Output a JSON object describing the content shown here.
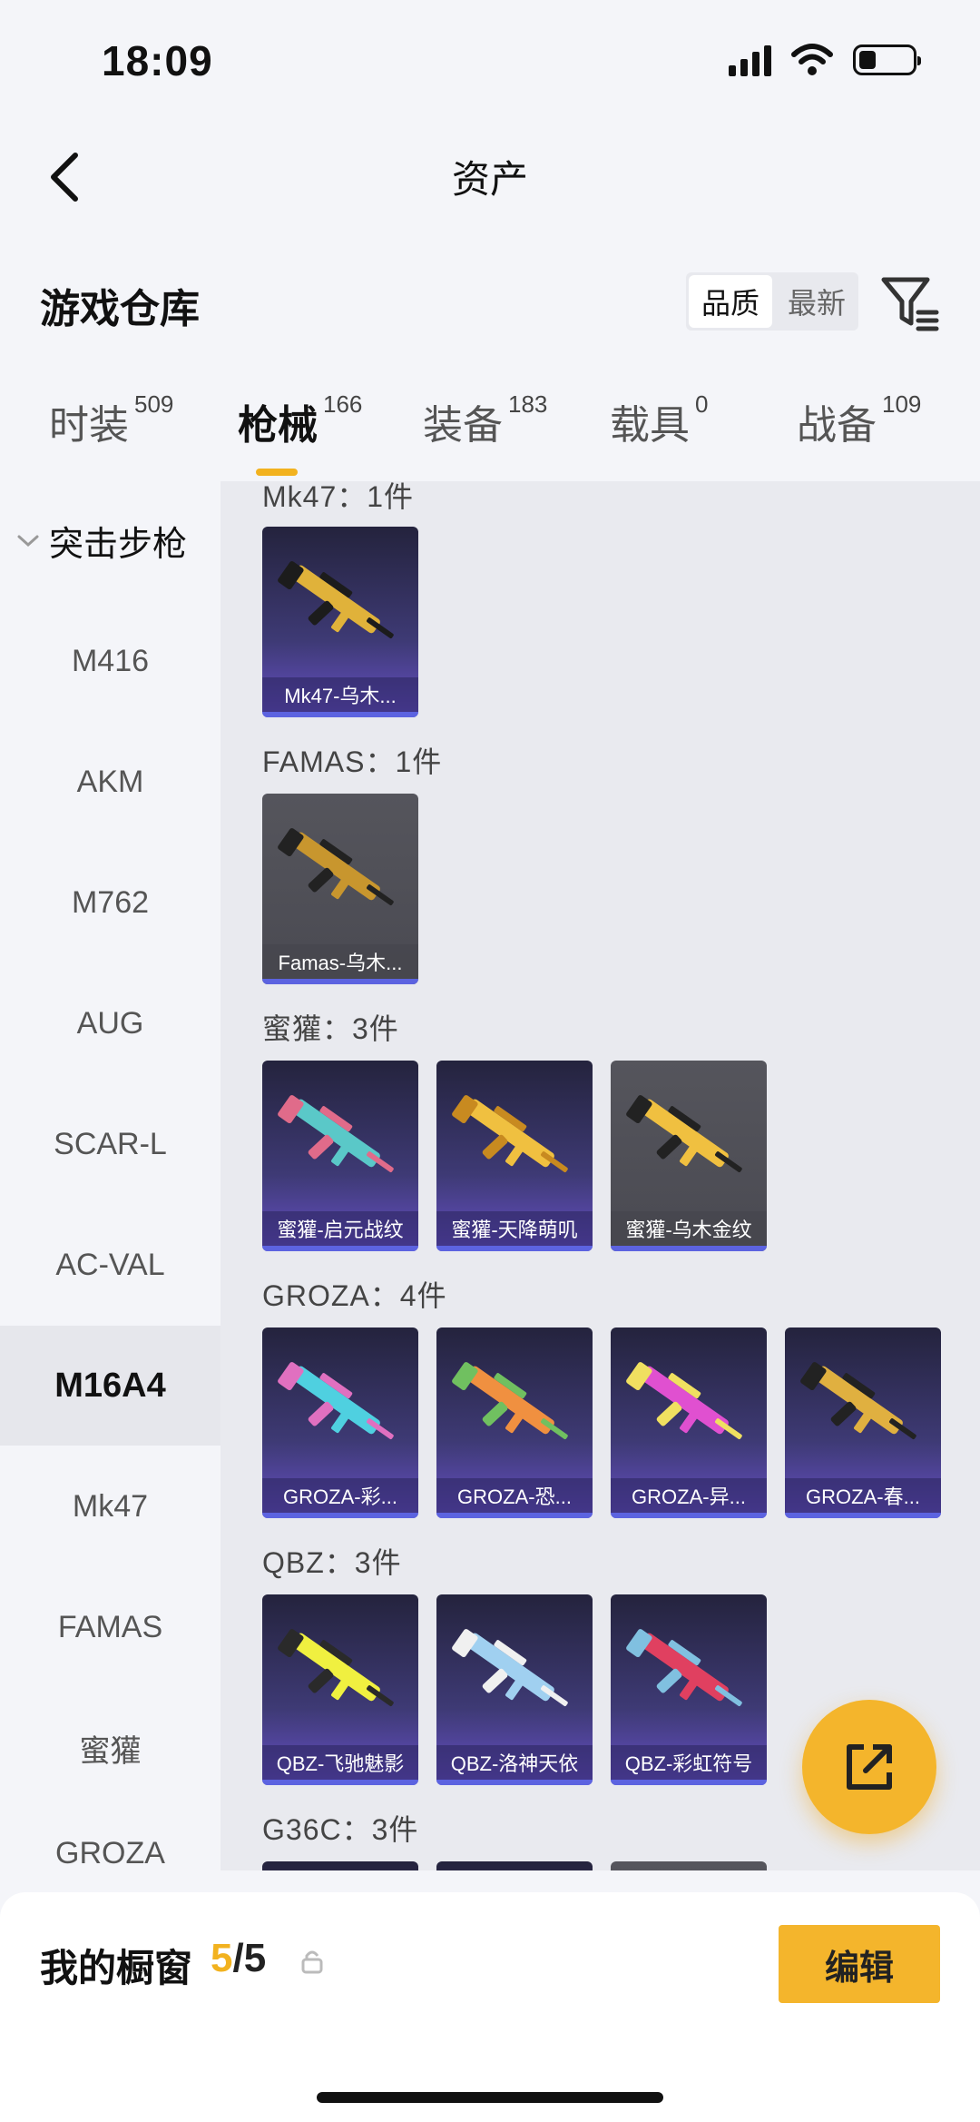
{
  "status": {
    "time": "18:09"
  },
  "nav": {
    "title": "资产"
  },
  "header": {
    "title": "游戏仓库",
    "sort_options": [
      "品质",
      "最新"
    ],
    "sort_active": "品质"
  },
  "tabs": [
    {
      "label": "时装",
      "count": "509"
    },
    {
      "label": "枪械",
      "count": "166"
    },
    {
      "label": "装备",
      "count": "183"
    },
    {
      "label": "载具",
      "count": "0"
    },
    {
      "label": "战备",
      "count": "109"
    }
  ],
  "active_tab": "枪械",
  "sidebar": {
    "category": "突击步枪",
    "items": [
      "M416",
      "AKM",
      "M762",
      "AUG",
      "SCAR-L",
      "AC-VAL",
      "M16A4",
      "Mk47",
      "FAMAS",
      "蜜獾",
      "GROZA"
    ],
    "active_item": "M16A4"
  },
  "groups": [
    {
      "title": "Mk47：1件",
      "items": [
        {
          "name": "Mk47-乌木...",
          "style": "purple"
        }
      ]
    },
    {
      "title": "FAMAS：1件",
      "items": [
        {
          "name": "Famas-乌木...",
          "style": "grey"
        }
      ]
    },
    {
      "title": "蜜獾：3件",
      "items": [
        {
          "name": "蜜獾-启元战纹",
          "style": "purple"
        },
        {
          "name": "蜜獾-天降萌叽",
          "style": "purple"
        },
        {
          "name": "蜜獾-乌木金纹",
          "style": "grey"
        }
      ]
    },
    {
      "title": "GROZA：4件",
      "items": [
        {
          "name": "GROZA-彩...",
          "style": "purple"
        },
        {
          "name": "GROZA-恐...",
          "style": "purple"
        },
        {
          "name": "GROZA-异...",
          "style": "purple"
        },
        {
          "name": "GROZA-春...",
          "style": "purple"
        }
      ]
    },
    {
      "title": "QBZ：3件",
      "items": [
        {
          "name": "QBZ-飞驰魅影",
          "style": "purple"
        },
        {
          "name": "QBZ-洛神天依",
          "style": "purple"
        },
        {
          "name": "QBZ-彩虹符号",
          "style": "purple"
        }
      ]
    },
    {
      "title": "G36C：3件",
      "items": []
    }
  ],
  "bottom": {
    "showcase_label": "我的橱窗",
    "showcase_current": "5",
    "showcase_total": "/5",
    "edit_label": "编辑"
  }
}
